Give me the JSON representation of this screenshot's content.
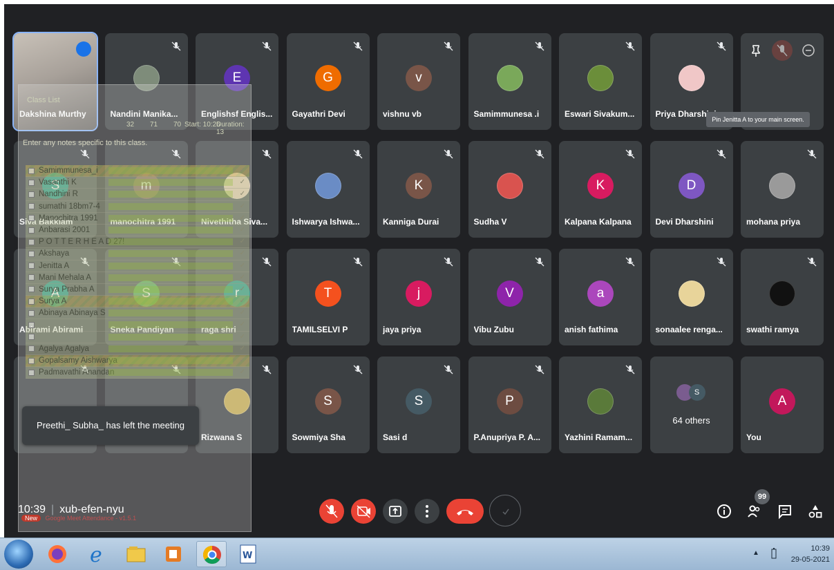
{
  "meeting": {
    "time": "10:39",
    "code": "xub-efen-nyu",
    "toast": "Preethi_ Subha_ has left the meeting",
    "tooltip": "Pin Jenitta A to your main screen.",
    "people_count": "99",
    "others_label": "64 others",
    "others_initial": "S"
  },
  "participants": [
    {
      "name": "Dakshina Murthy",
      "initial": "",
      "color": "",
      "type": "video"
    },
    {
      "name": "Nandini Manika...",
      "initial": "",
      "color": "#7e8c7a",
      "type": "pic"
    },
    {
      "name": "Englishsf Englis...",
      "initial": "E",
      "color": "#5e35b1",
      "type": "letter"
    },
    {
      "name": "Gayathri Devi",
      "initial": "G",
      "color": "#ef6c00",
      "type": "letter"
    },
    {
      "name": "vishnu vb",
      "initial": "v",
      "color": "#795548",
      "type": "letter"
    },
    {
      "name": "Samimmunesa .i",
      "initial": "",
      "color": "#7aa85a",
      "type": "pic"
    },
    {
      "name": "Eswari Sivakum...",
      "initial": "",
      "color": "#6b8e3a",
      "type": "pic"
    },
    {
      "name": "Priya Dharshini",
      "initial": "",
      "color": "#f0c7c7",
      "type": "pic"
    },
    {
      "name": "",
      "initial": "",
      "color": "",
      "type": "blank"
    },
    {
      "name": "Siva Bakkiam",
      "initial": "S",
      "color": "#00897b",
      "type": "letter"
    },
    {
      "name": "manochitra 1991",
      "initial": "m",
      "color": "#795548",
      "type": "letter"
    },
    {
      "name": "Nivethitha Siva...",
      "initial": "",
      "color": "#e6c6b0",
      "type": "pic"
    },
    {
      "name": "Ishwarya Ishwa...",
      "initial": "",
      "color": "#6a8cc5",
      "type": "pic"
    },
    {
      "name": "Kanniga Durai",
      "initial": "K",
      "color": "#795548",
      "type": "letter"
    },
    {
      "name": "Sudha V",
      "initial": "",
      "color": "#d9534f",
      "type": "pic"
    },
    {
      "name": "Kalpana Kalpana",
      "initial": "K",
      "color": "#d81b60",
      "type": "letter"
    },
    {
      "name": "Devi Dharshini",
      "initial": "D",
      "color": "#7e57c2",
      "type": "letter"
    },
    {
      "name": "mohana priya",
      "initial": "",
      "color": "#9a9a9a",
      "type": "pic"
    },
    {
      "name": "Abirami Abirami",
      "initial": "A",
      "color": "#00897b",
      "type": "letter"
    },
    {
      "name": "Sneka Pandiyan",
      "initial": "S",
      "color": "#43a047",
      "type": "letter"
    },
    {
      "name": "raga shri",
      "initial": "r",
      "color": "#00897b",
      "type": "letter"
    },
    {
      "name": "TAMILSELVI P",
      "initial": "T",
      "color": "#f4511e",
      "type": "letter"
    },
    {
      "name": "jaya priya",
      "initial": "j",
      "color": "#d81b60",
      "type": "letter"
    },
    {
      "name": "Vibu Zubu",
      "initial": "V",
      "color": "#8e24aa",
      "type": "letter"
    },
    {
      "name": "anish fathima",
      "initial": "a",
      "color": "#ab47bc",
      "type": "letter"
    },
    {
      "name": "sonaalee renga...",
      "initial": "",
      "color": "#e8d49a",
      "type": "pic"
    },
    {
      "name": "swathi ramya",
      "initial": "",
      "color": "#111111",
      "type": "pic"
    },
    {
      "name": "",
      "initial": "",
      "color": "",
      "type": "blank"
    },
    {
      "name": "",
      "initial": "",
      "color": "",
      "type": "blank"
    },
    {
      "name": "Rizwana S",
      "initial": "",
      "color": "#c2a84d",
      "type": "pic"
    },
    {
      "name": "Sowmiya Sha",
      "initial": "S",
      "color": "#795548",
      "type": "letter"
    },
    {
      "name": "Sasi d",
      "initial": "S",
      "color": "#455a64",
      "type": "letter"
    },
    {
      "name": "P.Anupriya P. A...",
      "initial": "P",
      "color": "#6d4c41",
      "type": "letter"
    },
    {
      "name": "Yazhini Ramam...",
      "initial": "",
      "color": "#5a7a3a",
      "type": "pic"
    },
    {
      "name": "",
      "initial": "",
      "color": "",
      "type": "others"
    },
    {
      "name": "You",
      "initial": "A",
      "color": "#c2185b",
      "type": "letter"
    }
  ],
  "attendance": {
    "header_title": "Class List",
    "header_stats": "32",
    "header_absent": "71",
    "header_present": "70",
    "header_start": "Start: 10:26",
    "header_duration": "Duration: 13",
    "notes_placeholder": "Enter any notes specific to this class.",
    "footer_label": "Google Meet Attendance - v1.5.1",
    "footer_badge": "New",
    "rows": [
      {
        "name": "Samimmunesa_i",
        "present": true
      },
      {
        "name": "Vasanthi K",
        "present": false
      },
      {
        "name": "Nandhini R",
        "present": false
      },
      {
        "name": "sumathi 18bm7-4",
        "present": false
      },
      {
        "name": "Manochitra 1991",
        "present": false
      },
      {
        "name": "Anbarasi 2001",
        "present": false
      },
      {
        "name": "P O T T E R H E A D 27!",
        "present": false
      },
      {
        "name": "Akshaya",
        "present": false
      },
      {
        "name": "Jenitta A",
        "present": false
      },
      {
        "name": "Mani Mehala A",
        "present": false
      },
      {
        "name": "Surya Prabha A",
        "present": false
      },
      {
        "name": "Surya A",
        "present": true
      },
      {
        "name": "Abinaya Abinaya S",
        "present": false
      },
      {
        "name": "",
        "present": false
      },
      {
        "name": "",
        "present": false
      },
      {
        "name": "Agalya Agalya",
        "present": false
      },
      {
        "name": "Gopalsamy Aishwarya",
        "present": true
      },
      {
        "name": "Padmavathi Anandan",
        "present": false
      }
    ]
  },
  "taskbar": {
    "time": "10:39",
    "date": "29-05-2021"
  }
}
